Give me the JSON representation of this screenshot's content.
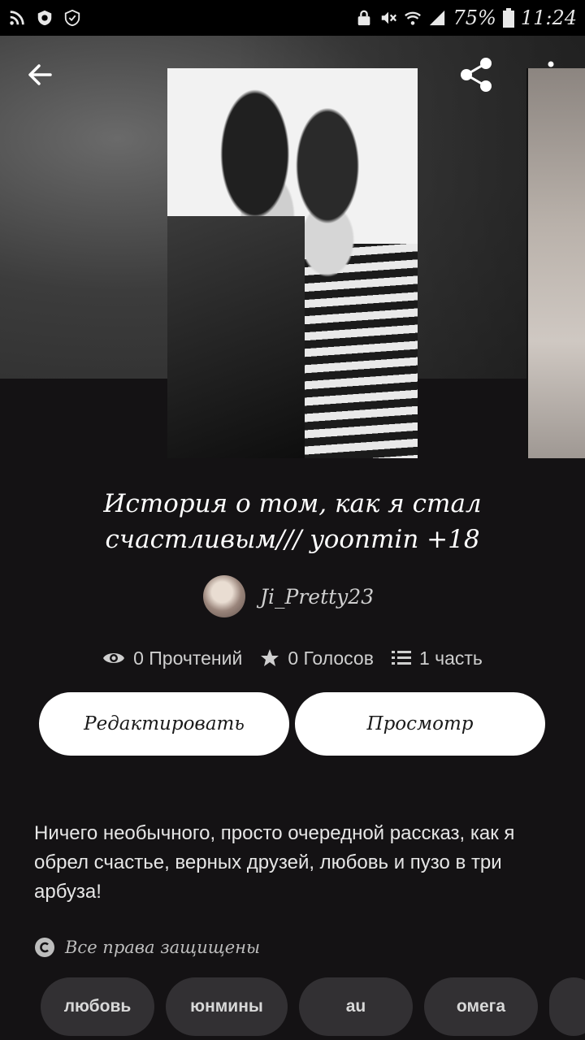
{
  "status_bar": {
    "battery": "75%",
    "time": "11:24",
    "icons": [
      "rss-icon",
      "shield-icon",
      "shield-check-icon",
      "lock-icon",
      "mute-icon",
      "wifi-icon",
      "signal-icon",
      "battery-icon"
    ]
  },
  "toolbar": {
    "back_icon": "arrow-left-icon",
    "share_icon": "share-icon",
    "menu_icon": "more-vertical-icon"
  },
  "story": {
    "title": "История о том, как я стал счастливым/// yoonmin +18",
    "author": "Ji_Pretty23",
    "stats": {
      "reads": "0 Прочтений",
      "votes": "0 Голосов",
      "parts": "1 часть"
    },
    "description": "Ничего необычного, просто очередной рассказ, как я обрел счастье, верных друзей, любовь и пузо в три арбуза!",
    "copyright": "Все права защищены"
  },
  "actions": {
    "edit_label": "Редактировать",
    "view_label": "Просмотр"
  },
  "tags": [
    {
      "label": "любовь"
    },
    {
      "label": "юнмины"
    },
    {
      "label": "au"
    },
    {
      "label": "омега"
    },
    {
      "label": ""
    }
  ]
}
